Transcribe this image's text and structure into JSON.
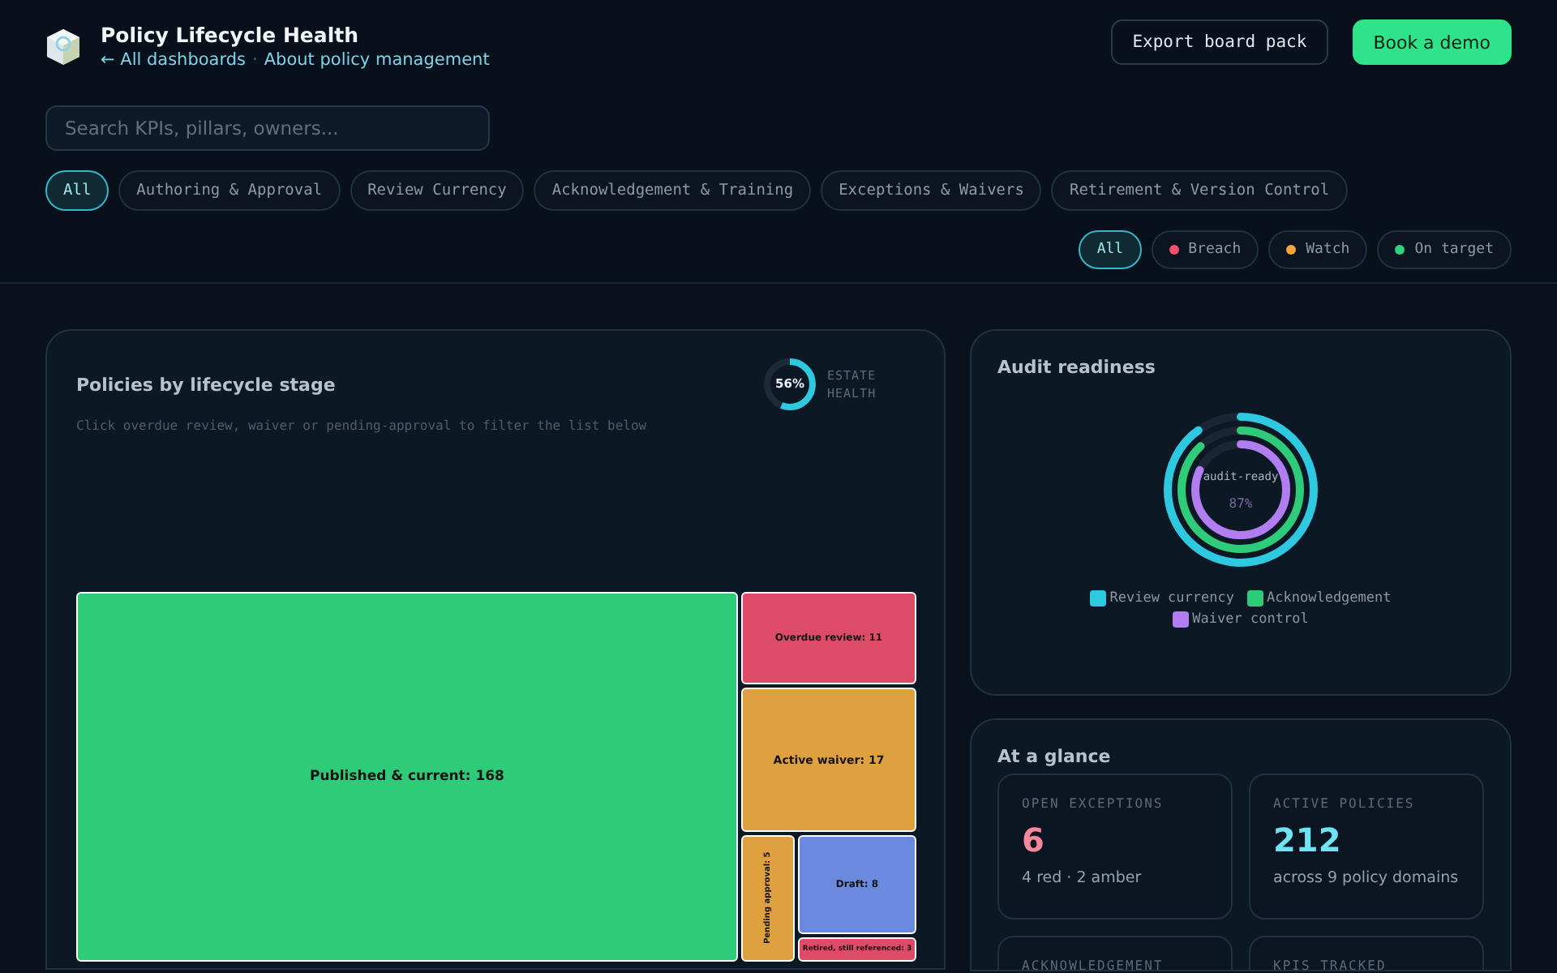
{
  "header": {
    "title": "Policy Lifecycle Health",
    "links": [
      {
        "label": "← All dashboards"
      },
      {
        "label": "About policy management"
      }
    ],
    "link_separator": "·",
    "buttons": [
      {
        "label": "Export board pack",
        "kind": "outline"
      },
      {
        "label": "Book a demo",
        "kind": "primary"
      }
    ]
  },
  "search": {
    "placeholder": "Search KPIs, pillars, owners..."
  },
  "pillar_filters": [
    {
      "label": "All",
      "selected": true
    },
    {
      "label": "Authoring & Approval",
      "selected": false
    },
    {
      "label": "Review Currency",
      "selected": false
    },
    {
      "label": "Acknowledgement & Training",
      "selected": false
    },
    {
      "label": "Exceptions & Waivers",
      "selected": false
    },
    {
      "label": "Retirement & Version Control",
      "selected": false
    }
  ],
  "status_filters": [
    {
      "label": "All",
      "selected": true
    },
    {
      "label": "Breach",
      "selected": false,
      "color": "#f0506e"
    },
    {
      "label": "Watch",
      "selected": false,
      "color": "#f5a63b"
    },
    {
      "label": "On target",
      "selected": false,
      "color": "#2ed47a"
    }
  ],
  "lifecycle_card": {
    "title": "Policies by lifecycle stage",
    "estate_health": {
      "value": "56%",
      "level": 0.56,
      "label": "ESTATE HEALTH"
    },
    "hint": "Click overdue review, waiver or pending-approval to filter the list below",
    "tiles": [
      {
        "label": "Published & current: 168",
        "color": "#2ecb78"
      },
      {
        "label": "Overdue review: 11",
        "color": "#de4b68"
      },
      {
        "label": "Active waiver: 17",
        "color": "#dfa03f"
      },
      {
        "label": "Pending approval: 5",
        "color": "#dfa03f"
      },
      {
        "label": "Draft: 8",
        "color": "#6a8ae0"
      },
      {
        "label": "Retired, still referenced: 3",
        "color": "#de4b68"
      }
    ]
  },
  "audit_card": {
    "title": "Audit readiness",
    "center_label": "audit-ready",
    "center_value": "87%",
    "rings": [
      {
        "label": "Review currency",
        "color": "#2ec8e0",
        "level": 0.9
      },
      {
        "label": "Acknowledgement",
        "color": "#2ecb78",
        "level": 0.88
      },
      {
        "label": "Waiver control",
        "color": "#b07ef0",
        "level": 0.82
      }
    ]
  },
  "glance_card": {
    "title": "At a glance",
    "kpis": [
      {
        "label": "OPEN EXCEPTIONS",
        "value": "6",
        "note": "4 red · 2 amber",
        "color": "#f7889c"
      },
      {
        "label": "ACTIVE POLICIES",
        "value": "212",
        "note": "across 9 policy domains",
        "color": "#6fe3f2"
      },
      {
        "label": "ACKNOWLEDGEMENT"
      },
      {
        "label": "KPIS TRACKED"
      }
    ]
  }
}
